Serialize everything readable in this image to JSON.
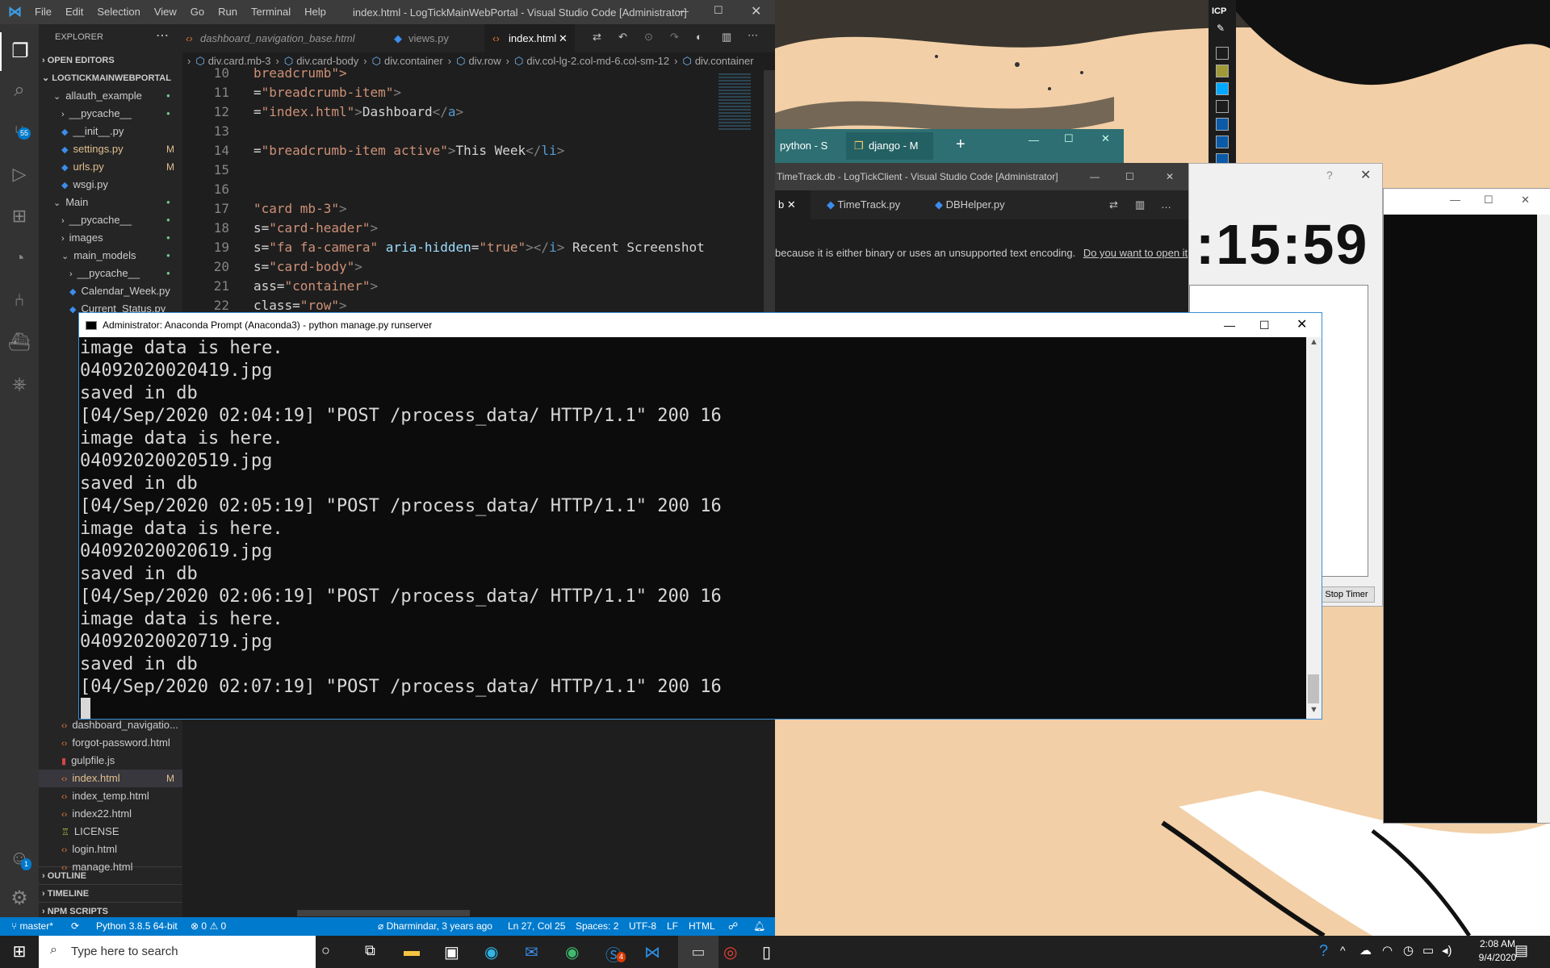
{
  "vscode": {
    "menu": [
      "File",
      "Edit",
      "Selection",
      "View",
      "Go",
      "Run",
      "Terminal",
      "Help"
    ],
    "window_title": "index.html - LogTickMainWebPortal - Visual Studio Code [Administrator]",
    "scm_badge": "55",
    "accounts_badge": "1",
    "sidebar": {
      "header": "EXPLORER",
      "open_editors": "OPEN EDITORS",
      "project": "LOGTICKMAINWEBPORTAL",
      "items": [
        {
          "label": "allauth_example",
          "type": "folder-open",
          "indent": 1,
          "badge": "●"
        },
        {
          "label": "__pycache__",
          "type": "folder",
          "indent": 2,
          "badge": "●"
        },
        {
          "label": "__init__.py",
          "type": "py",
          "indent": 2,
          "badge": ""
        },
        {
          "label": "settings.py",
          "type": "py",
          "indent": 2,
          "badge": "M"
        },
        {
          "label": "urls.py",
          "type": "py",
          "indent": 2,
          "badge": "M"
        },
        {
          "label": "wsgi.py",
          "type": "py",
          "indent": 2,
          "badge": ""
        },
        {
          "label": "Main",
          "type": "folder-open",
          "indent": 1,
          "badge": "●"
        },
        {
          "label": "__pycache__",
          "type": "folder",
          "indent": 2,
          "badge": "●"
        },
        {
          "label": "images",
          "type": "folder",
          "indent": 2,
          "badge": "●"
        },
        {
          "label": "main_models",
          "type": "folder-open",
          "indent": 2,
          "badge": "●"
        },
        {
          "label": "__pycache__",
          "type": "folder",
          "indent": 3,
          "badge": "●"
        },
        {
          "label": "Calendar_Week.py",
          "type": "py",
          "indent": 3,
          "badge": ""
        },
        {
          "label": "Current_Status.py",
          "type": "py",
          "indent": 3,
          "badge": ""
        }
      ],
      "bottom_items": [
        {
          "label": "dashboard_navigatio...",
          "type": "html",
          "badge": ""
        },
        {
          "label": "forgot-password.html",
          "type": "html",
          "badge": ""
        },
        {
          "label": "gulpfile.js",
          "type": "js",
          "badge": ""
        },
        {
          "label": "index.html",
          "type": "html",
          "badge": "M"
        },
        {
          "label": "index_temp.html",
          "type": "html",
          "badge": ""
        },
        {
          "label": "index22.html",
          "type": "html",
          "badge": ""
        },
        {
          "label": "LICENSE",
          "type": "license",
          "badge": ""
        },
        {
          "label": "login.html",
          "type": "html",
          "badge": ""
        },
        {
          "label": "manage.html",
          "type": "html",
          "badge": ""
        }
      ],
      "sections": [
        "OUTLINE",
        "TIMELINE",
        "NPM SCRIPTS"
      ]
    },
    "tabs": [
      {
        "label": "dashboard_navigation_base.html",
        "active": false
      },
      {
        "label": "views.py",
        "active": false
      },
      {
        "label": "index.html",
        "active": true
      }
    ],
    "breadcrumb": [
      "div.card.mb-3",
      "div.card-body",
      "div.container",
      "div.row",
      "div.col-lg-2.col-md-6.col-sm-12",
      "div.container"
    ],
    "code_lines": [
      {
        "n": "10",
        "parts": [
          [
            "breadcrumb\">",
            "#ce9178"
          ]
        ]
      },
      {
        "n": "11",
        "parts": [
          [
            "=",
            "#d4d4d4"
          ],
          [
            "\"breadcrumb-item\"",
            "#ce9178"
          ],
          [
            ">",
            "#808080"
          ]
        ]
      },
      {
        "n": "12",
        "parts": [
          [
            "=",
            "#d4d4d4"
          ],
          [
            "\"",
            "#ce9178"
          ],
          [
            "index.html",
            "#ce9178"
          ],
          [
            "\"",
            "#ce9178"
          ],
          [
            ">",
            "#808080"
          ],
          [
            "Dashboard",
            "#d4d4d4"
          ],
          [
            "</",
            "#808080"
          ],
          [
            "a",
            "#569cd6"
          ],
          [
            ">",
            "#808080"
          ]
        ]
      },
      {
        "n": "13",
        "parts": []
      },
      {
        "n": "14",
        "parts": [
          [
            "=",
            "#d4d4d4"
          ],
          [
            "\"breadcrumb-item active\"",
            "#ce9178"
          ],
          [
            ">",
            "#808080"
          ],
          [
            "This Week",
            "#d4d4d4"
          ],
          [
            "</",
            "#808080"
          ],
          [
            "li",
            "#569cd6"
          ],
          [
            ">",
            "#808080"
          ]
        ]
      },
      {
        "n": "15",
        "parts": []
      },
      {
        "n": "16",
        "parts": []
      },
      {
        "n": "17",
        "parts": [
          [
            "\"card mb-3\"",
            "#ce9178"
          ],
          [
            ">",
            "#808080"
          ]
        ]
      },
      {
        "n": "18",
        "parts": [
          [
            "s=",
            "#d4d4d4"
          ],
          [
            "\"card-header\"",
            "#ce9178"
          ],
          [
            ">",
            "#808080"
          ]
        ]
      },
      {
        "n": "19",
        "parts": [
          [
            "s=",
            "#d4d4d4"
          ],
          [
            "\"fa fa-camera\"",
            "#ce9178"
          ],
          [
            " aria-hidden",
            "#9cdcfe"
          ],
          [
            "=",
            "#d4d4d4"
          ],
          [
            "\"true\"",
            "#ce9178"
          ],
          [
            "></",
            "#808080"
          ],
          [
            "i",
            "#569cd6"
          ],
          [
            ">",
            "#808080"
          ],
          [
            " Recent Screenshot",
            "#d4d4d4"
          ]
        ]
      },
      {
        "n": "20",
        "parts": [
          [
            "s=",
            "#d4d4d4"
          ],
          [
            "\"card-body\"",
            "#ce9178"
          ],
          [
            ">",
            "#808080"
          ]
        ]
      },
      {
        "n": "21",
        "parts": [
          [
            "ass=",
            "#d4d4d4"
          ],
          [
            "\"container\"",
            "#ce9178"
          ],
          [
            ">",
            "#808080"
          ]
        ]
      },
      {
        "n": "22",
        "parts": [
          [
            "class=",
            "#d4d4d4"
          ],
          [
            "\"row\"",
            "#ce9178"
          ],
          [
            ">",
            "#808080"
          ]
        ]
      }
    ],
    "status": {
      "branch": "master*",
      "python": "Python 3.8.5 64-bit",
      "errors": "0",
      "warnings": "0",
      "blame": "Dharmindar, 3 years ago",
      "position": "Ln 27, Col 25",
      "spaces": "Spaces: 2",
      "encoding": "UTF-8",
      "eol": "LF",
      "language": "HTML"
    }
  },
  "terminal": {
    "title": "Administrator: Anaconda Prompt (Anaconda3) - python  manage.py runserver",
    "lines": [
      "image data is here.",
      "04092020020419.jpg",
      "saved in db",
      "[04/Sep/2020 02:04:19] \"POST /process_data/ HTTP/1.1\" 200 16",
      "image data is here.",
      "04092020020519.jpg",
      "saved in db",
      "[04/Sep/2020 02:05:19] \"POST /process_data/ HTTP/1.1\" 200 16",
      "image data is here.",
      "04092020020619.jpg",
      "saved in db",
      "[04/Sep/2020 02:06:19] \"POST /process_data/ HTTP/1.1\" 200 16",
      "image data is here.",
      "04092020020719.jpg",
      "saved in db",
      "[04/Sep/2020 02:07:19] \"POST /process_data/ HTTP/1.1\" 200 16"
    ]
  },
  "terminal_tabs": {
    "tabs": [
      {
        "label": "python - S",
        "active": false
      },
      {
        "label": "django - M",
        "active": true
      }
    ]
  },
  "timetrack": {
    "title": "TimeTrack.db - LogTickClient - Visual Studio Code [Administrator]",
    "tabs": [
      "b",
      "TimeTrack.py",
      "DBHelper.py"
    ],
    "message": "because it is either binary or uses an unsupported text encoding.",
    "link": "Do you want to open it"
  },
  "timer": {
    "title_help": "?",
    "display": ":15:59",
    "button": "Stop Timer"
  },
  "icp": {
    "label": "ICP",
    "swatches": [
      "#ffffff",
      "#9e9a38",
      "#00a8ff",
      "#ffffff",
      "#0a5aa8",
      "#0a5aa8",
      "#0a5aa8"
    ]
  },
  "taskbar": {
    "search_placeholder": "Type here to search",
    "time": "2:08 AM",
    "date": "9/4/2020",
    "notif_badge": "4"
  },
  "colors": {
    "vscode_blue": "#007acc",
    "terminal_bg": "#0c0c0c",
    "taskbar_bg": "#202020",
    "accent_teal": "#2d6f73"
  }
}
